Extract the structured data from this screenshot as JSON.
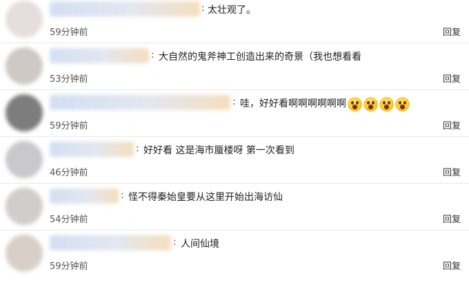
{
  "comments": [
    {
      "text": "太壮观了。",
      "time": "59分钟前",
      "reply": "回复",
      "avatar_color": "#e6dede"
    },
    {
      "text": "大自然的鬼斧神工创造出来的奇景（我也想看看",
      "time": "53分钟前",
      "reply": "回复",
      "avatar_color": "#cfc9c6"
    },
    {
      "text": "哇，好好看啊啊啊啊啊啊",
      "time": "59分钟前",
      "reply": "回复",
      "avatar_color": "#7d7d7d",
      "emoji": "surprised-face-icon",
      "emoji_count": 4
    },
    {
      "text": "好好看 这是海市蜃楼呀 第一次看到",
      "time": "46分钟前",
      "reply": "回复",
      "avatar_color": "#c9c9cc"
    },
    {
      "text": "怪不得秦始皇要从这里开始出海访仙",
      "time": "54分钟前",
      "reply": "回复",
      "avatar_color": "#d0cdca"
    },
    {
      "text": "人间仙境",
      "time": "59分钟前",
      "reply": "回复",
      "avatar_color": "#d8cfc9"
    }
  ]
}
